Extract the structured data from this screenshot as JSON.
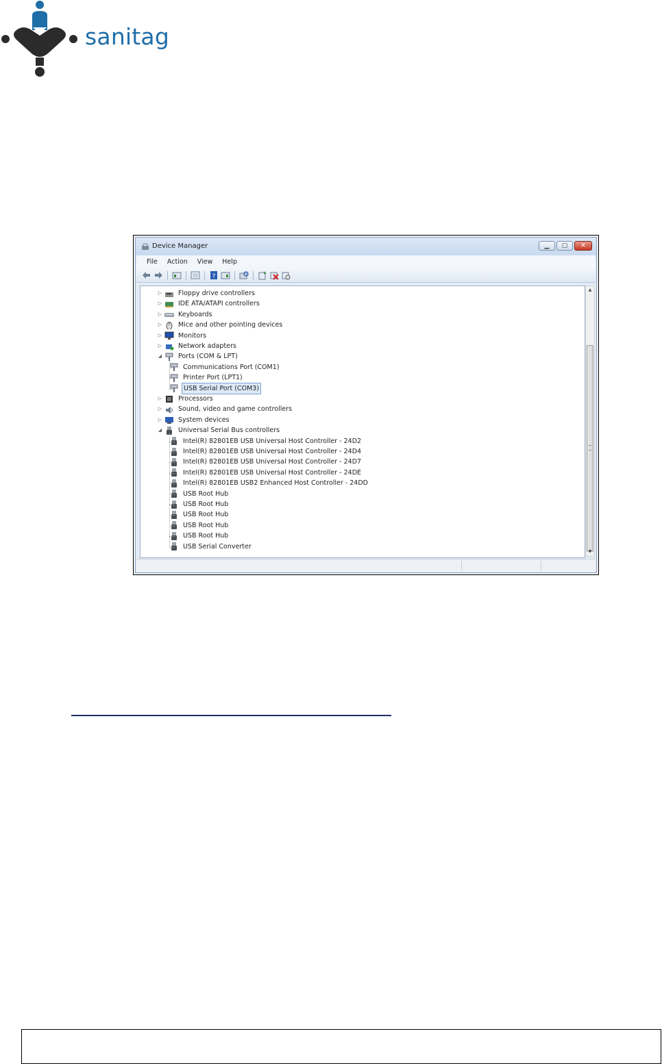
{
  "brand": {
    "name": "sanitag",
    "color": "#1f6ea8",
    "logo_dark": "#2b2b2b"
  },
  "window": {
    "title": "Device Manager",
    "controls": [
      "minimize",
      "maximize",
      "close"
    ],
    "menu": [
      "File",
      "Action",
      "View",
      "Help"
    ],
    "toolbar_icons": [
      "back-arrow-icon",
      "forward-arrow-icon",
      "properties-icon",
      "show-hide-console-tree-icon",
      "help-icon",
      "view-icon",
      "scan-hardware-icon",
      "update-driver-icon",
      "uninstall-icon",
      "disable-icon"
    ]
  },
  "tree": [
    {
      "label": "Floppy drive controllers",
      "level": 0,
      "expander": "collapsed",
      "icon": "floppy-drive-icon"
    },
    {
      "label": "IDE ATA/ATAPI controllers",
      "level": 0,
      "expander": "collapsed",
      "icon": "ide-controller-icon"
    },
    {
      "label": "Keyboards",
      "level": 0,
      "expander": "collapsed",
      "icon": "keyboard-icon"
    },
    {
      "label": "Mice and other pointing devices",
      "level": 0,
      "expander": "collapsed",
      "icon": "mouse-icon"
    },
    {
      "label": "Monitors",
      "level": 0,
      "expander": "collapsed",
      "icon": "monitor-icon"
    },
    {
      "label": "Network adapters",
      "level": 0,
      "expander": "collapsed",
      "icon": "network-adapter-icon"
    },
    {
      "label": "Ports (COM & LPT)",
      "level": 0,
      "expander": "expanded",
      "icon": "port-icon"
    },
    {
      "label": "Communications Port (COM1)",
      "level": 1,
      "icon": "port-icon"
    },
    {
      "label": "Printer Port (LPT1)",
      "level": 1,
      "icon": "port-icon"
    },
    {
      "label": "USB Serial Port (COM3)",
      "level": 1,
      "icon": "port-icon",
      "selected": true
    },
    {
      "label": "Processors",
      "level": 0,
      "expander": "collapsed",
      "icon": "processor-icon"
    },
    {
      "label": "Sound, video and game controllers",
      "level": 0,
      "expander": "collapsed",
      "icon": "speaker-icon"
    },
    {
      "label": "System devices",
      "level": 0,
      "expander": "collapsed",
      "icon": "system-devices-icon"
    },
    {
      "label": "Universal Serial Bus controllers",
      "level": 0,
      "expander": "expanded",
      "icon": "usb-icon"
    },
    {
      "label": "Intel(R) 82801EB USB Universal Host Controller - 24D2",
      "level": 1,
      "icon": "usb-icon"
    },
    {
      "label": "Intel(R) 82801EB USB Universal Host Controller - 24D4",
      "level": 1,
      "icon": "usb-icon"
    },
    {
      "label": "Intel(R) 82801EB USB Universal Host Controller - 24D7",
      "level": 1,
      "icon": "usb-icon"
    },
    {
      "label": "Intel(R) 82801EB USB Universal Host Controller - 24DE",
      "level": 1,
      "icon": "usb-icon"
    },
    {
      "label": "Intel(R) 82801EB USB2 Enhanced Host Controller - 24DD",
      "level": 1,
      "icon": "usb-icon"
    },
    {
      "label": "USB Root Hub",
      "level": 1,
      "icon": "usb-icon"
    },
    {
      "label": "USB Root Hub",
      "level": 1,
      "icon": "usb-icon"
    },
    {
      "label": "USB Root Hub",
      "level": 1,
      "icon": "usb-icon"
    },
    {
      "label": "USB Root Hub",
      "level": 1,
      "icon": "usb-icon"
    },
    {
      "label": "USB Root Hub",
      "level": 1,
      "icon": "usb-icon"
    },
    {
      "label": "USB Serial Converter",
      "level": 1,
      "icon": "usb-icon"
    }
  ]
}
